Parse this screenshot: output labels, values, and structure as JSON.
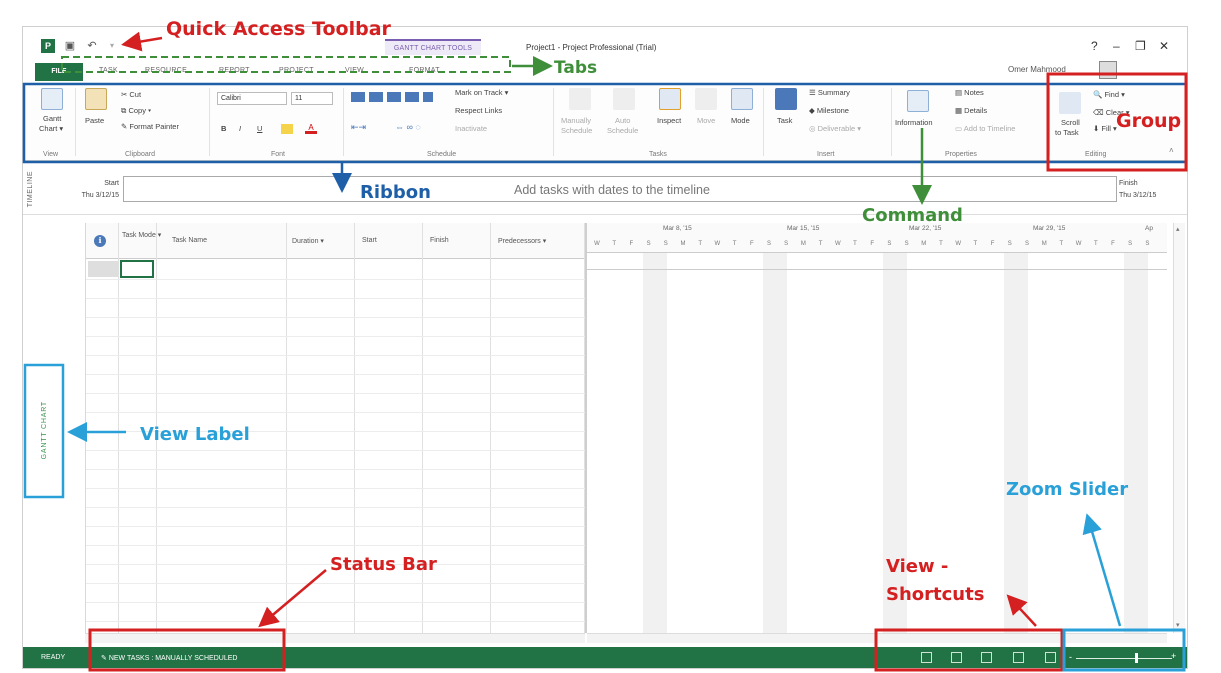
{
  "window": {
    "app_title": "Project1 - Project Professional (Trial)",
    "gantt_chart_tools": "GANTT CHART TOOLS",
    "user_name": "Omer Mahmood",
    "controls": [
      "?",
      "–",
      "❐",
      "✕"
    ]
  },
  "tabs": {
    "file": "FILE",
    "items": [
      "TASK",
      "RESOURCE",
      "REPORT",
      "PROJECT",
      "VIEW",
      "FORMAT"
    ]
  },
  "ribbon": {
    "view": {
      "gantt_chart": "Gantt",
      "gantt_chart2": "Chart ▾",
      "label": "View"
    },
    "clipboard": {
      "paste": "Paste",
      "cut": "Cut",
      "copy": "Copy ▾",
      "format_painter": "Format Painter",
      "label": "Clipboard"
    },
    "font": {
      "family": "Calibri",
      "size": "11",
      "bold": "B",
      "italic": "I",
      "underline": "U",
      "label": "Font"
    },
    "schedule": {
      "mark_on_track": "Mark on Track ▾",
      "respect_links": "Respect Links",
      "inactivate": "Inactivate",
      "label": "Schedule"
    },
    "tasks": {
      "manually": "Manually",
      "schedule": "Schedule",
      "auto": "Auto",
      "auto_schedule": "Schedule",
      "inspect": "Inspect",
      "move": "Move",
      "mode": "Mode",
      "label": "Tasks"
    },
    "insert": {
      "task": "Task",
      "summary": "Summary",
      "milestone": "Milestone",
      "deliverable": "Deliverable ▾",
      "label": "Insert"
    },
    "properties": {
      "information": "Information",
      "notes": "Notes",
      "details": "Details",
      "add_to_timeline": "Add to Timeline",
      "label": "Properties"
    },
    "editing": {
      "scroll": "Scroll",
      "to_task": "to Task",
      "find": "Find ▾",
      "clear": "Clear ▾",
      "fill": "Fill ▾",
      "label": "Editing"
    }
  },
  "timeline": {
    "vertical_label": "TIMELINE",
    "start_label": "Start",
    "start_date": "Thu 3/12/15",
    "finish_label": "Finish",
    "finish_date": "Thu 3/12/15",
    "placeholder": "Add tasks with dates to the timeline"
  },
  "sheet": {
    "columns": [
      "Task Mode ▾",
      "Task Name",
      "Duration ▾",
      "Start",
      "Finish",
      "Predecessors ▾"
    ],
    "info_icon": "ℹ"
  },
  "chart": {
    "weeks": [
      "Mar 8, '15",
      "Mar 15, '15",
      "Mar 22, '15",
      "Mar 29, '15",
      "Ap"
    ],
    "days": [
      "W",
      "T",
      "F",
      "S",
      "S",
      "M",
      "T",
      "W",
      "T",
      "F",
      "S",
      "S",
      "M",
      "T",
      "W",
      "T",
      "F",
      "S",
      "S",
      "M",
      "T",
      "W",
      "T",
      "F",
      "S",
      "S",
      "M",
      "T",
      "W",
      "T",
      "F",
      "S",
      "S"
    ]
  },
  "view_label": "GANTT CHART",
  "status": {
    "ready": "READY",
    "new_tasks": "NEW TASKS : MANUALLY SCHEDULED"
  },
  "annotations": {
    "quick_access_toolbar": "Quick Access Toolbar",
    "tabs": "Tabs",
    "ribbon": "Ribbon",
    "group": "Group",
    "command": "Command",
    "view_label": "View Label",
    "status_bar": "Status Bar",
    "view_shortcuts_1": "View -",
    "view_shortcuts_2": "Shortcuts",
    "zoom_slider": "Zoom Slider"
  },
  "colors": {
    "annotation_red": "#d42020",
    "annotation_green": "#3f8f3a",
    "annotation_blue": "#1f5fa8",
    "annotation_cyan": "#2aa0d8",
    "office_green": "#217346",
    "tools_purple": "#7a5fb0"
  }
}
